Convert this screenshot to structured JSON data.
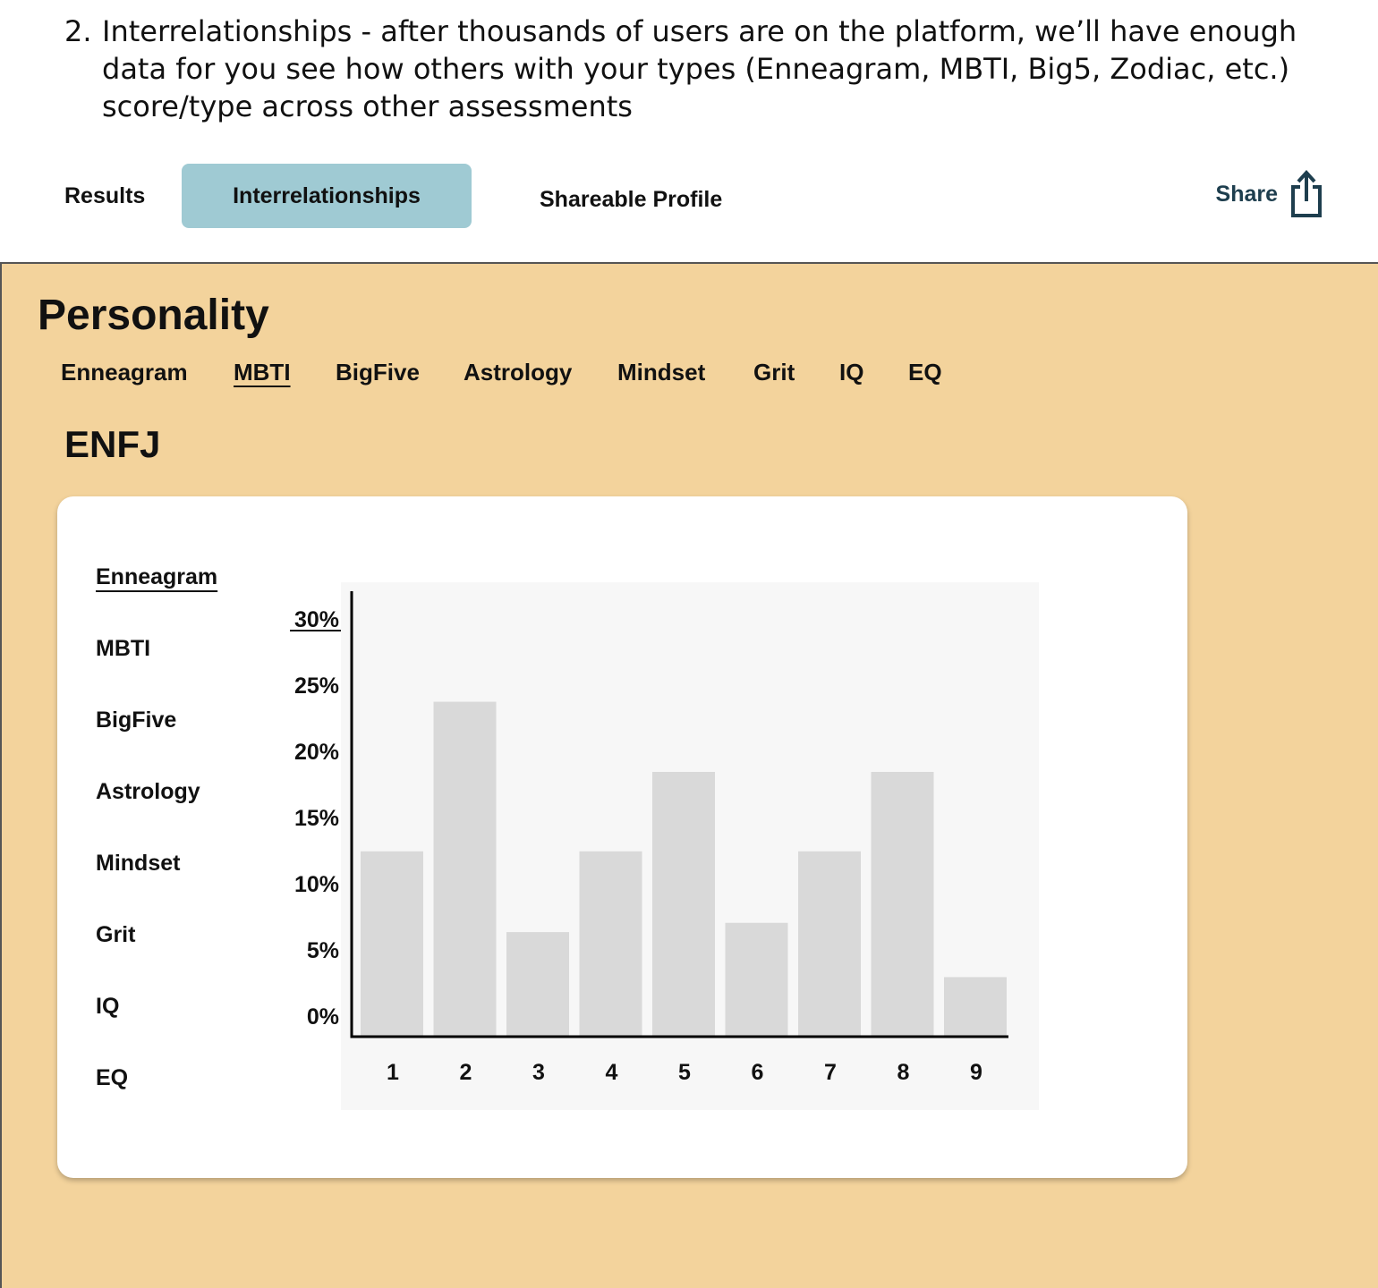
{
  "intro": {
    "number": "2.",
    "text": "Interrelationships - after thousands of users are on the platform, we’ll have enough data for you see how others with your types (Enneagram, MBTI, Big5, Zodiac, etc.) score/type across other assessments"
  },
  "tabs": {
    "results": "Results",
    "interrelationships": "Interrelationships",
    "shareable_profile": "Shareable Profile",
    "share": "Share",
    "active_color": "#9fcad3"
  },
  "section": {
    "heading": "Personality",
    "subnav": [
      "Enneagram",
      "MBTI",
      "BigFive",
      "Astrology",
      "Mindset",
      "Grit",
      "IQ",
      "EQ"
    ],
    "subnav_active": "MBTI",
    "type_title": "ENFJ",
    "background": "#f3d39c"
  },
  "card": {
    "sidelist": [
      "Enneagram",
      "MBTI",
      "BigFive",
      "Astrology",
      "Mindset",
      "Grit",
      "IQ",
      "EQ"
    ],
    "sidelist_active": "Enneagram"
  },
  "chart_data": {
    "type": "bar",
    "categories": [
      "1",
      "2",
      "3",
      "4",
      "5",
      "6",
      "7",
      "8",
      "9"
    ],
    "values": [
      14,
      25.3,
      7.9,
      14,
      20,
      8.6,
      14,
      20,
      4.5
    ],
    "yticks": [
      "0%",
      "5%",
      "10%",
      "15%",
      "20%",
      "25%",
      "30%"
    ],
    "ylim": [
      0,
      30
    ],
    "bar_color": "#d9d9d9",
    "grid": false
  }
}
